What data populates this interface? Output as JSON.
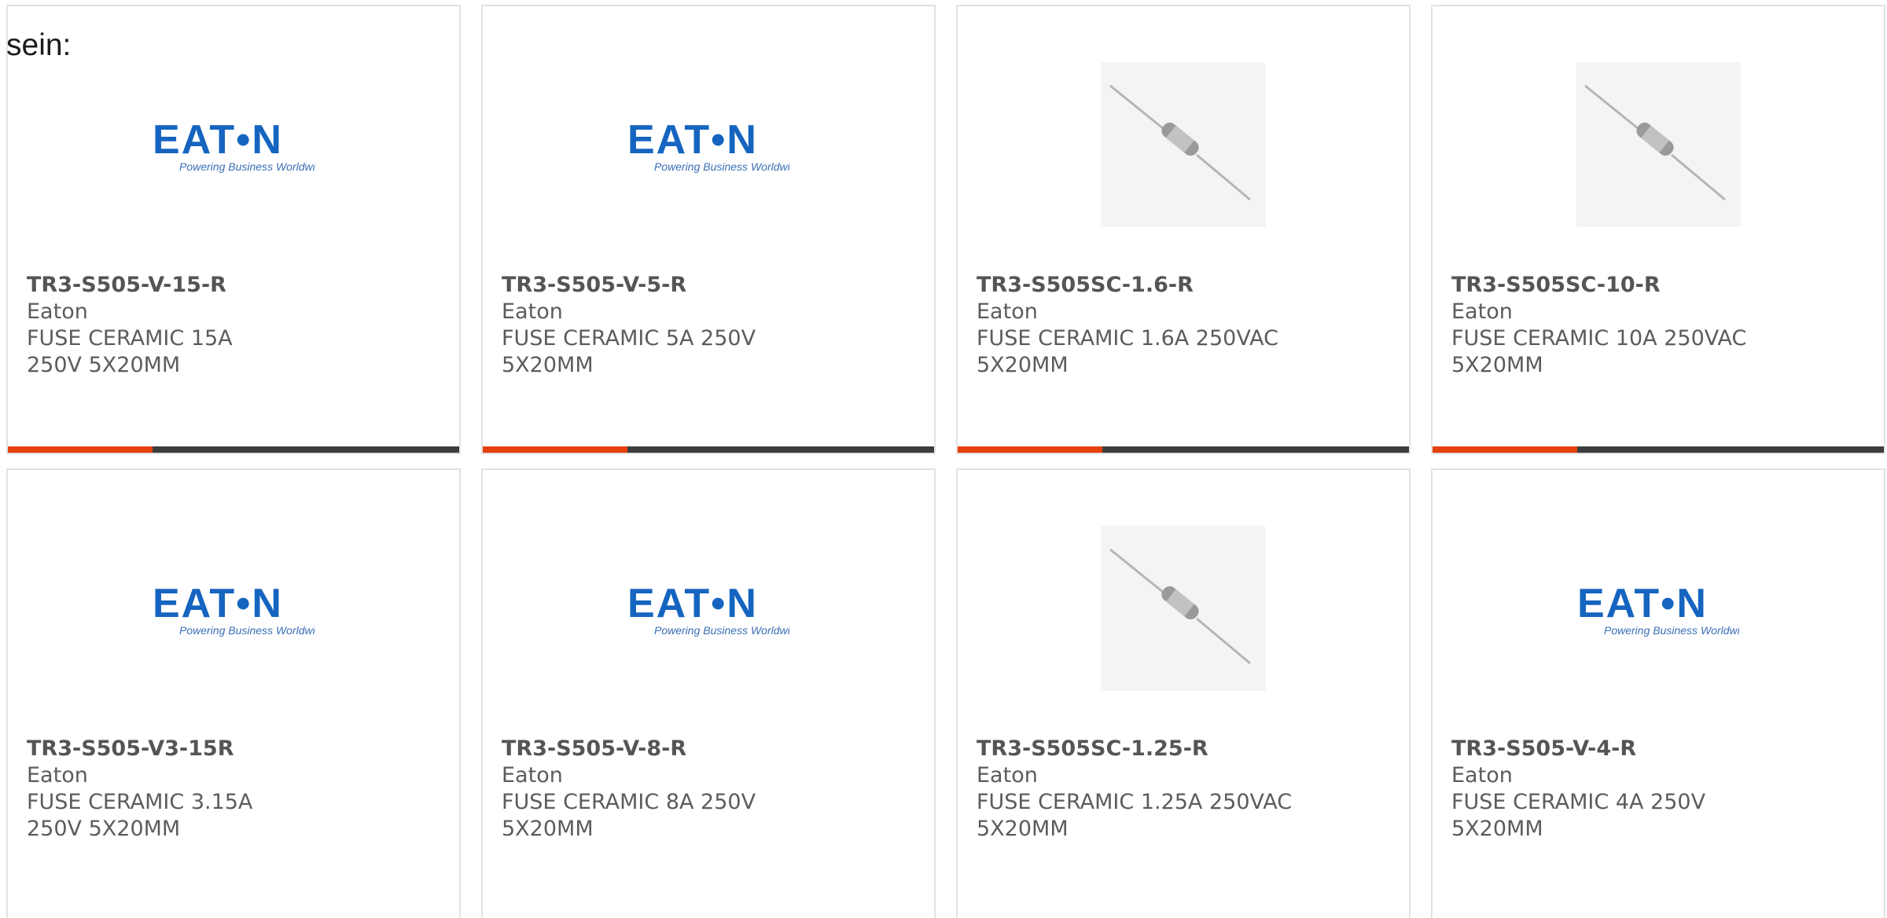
{
  "lead_text": "sein:",
  "products": [
    {
      "part_number": "TR3-S505-V-15-R",
      "manufacturer": "Eaton",
      "description": "FUSE CERAMIC 15A 250V 5X20MM",
      "image": "eaton-logo"
    },
    {
      "part_number": "TR3-S505-V-5-R",
      "manufacturer": "Eaton",
      "description": "FUSE CERAMIC 5A 250V 5X20MM",
      "image": "eaton-logo"
    },
    {
      "part_number": "TR3-S505SC-1.6-R",
      "manufacturer": "Eaton",
      "description": "FUSE CERAMIC 1.6A 250VAC 5X20MM",
      "image": "fuse-photo"
    },
    {
      "part_number": "TR3-S505SC-10-R",
      "manufacturer": "Eaton",
      "description": "FUSE CERAMIC 10A 250VAC 5X20MM",
      "image": "fuse-photo"
    },
    {
      "part_number": "TR3-S505-V3-15R",
      "manufacturer": "Eaton",
      "description": "FUSE CERAMIC 3.15A 250V 5X20MM",
      "image": "eaton-logo"
    },
    {
      "part_number": "TR3-S505-V-8-R",
      "manufacturer": "Eaton",
      "description": "FUSE CERAMIC 8A 250V 5X20MM",
      "image": "eaton-logo"
    },
    {
      "part_number": "TR3-S505SC-1.25-R",
      "manufacturer": "Eaton",
      "description": "FUSE CERAMIC 1.25A 250VAC 5X20MM",
      "image": "fuse-photo"
    },
    {
      "part_number": "TR3-S505-V-4-R",
      "manufacturer": "Eaton",
      "description": "FUSE CERAMIC 4A 250V 5X20MM",
      "image": "eaton-logo"
    }
  ],
  "logo": {
    "wordmark": "EATON",
    "tagline": "Powering Business Worldwide"
  },
  "colors": {
    "accent": "#e6400f",
    "bar": "#3d3d3d",
    "eaton_blue": "#1565c0"
  }
}
